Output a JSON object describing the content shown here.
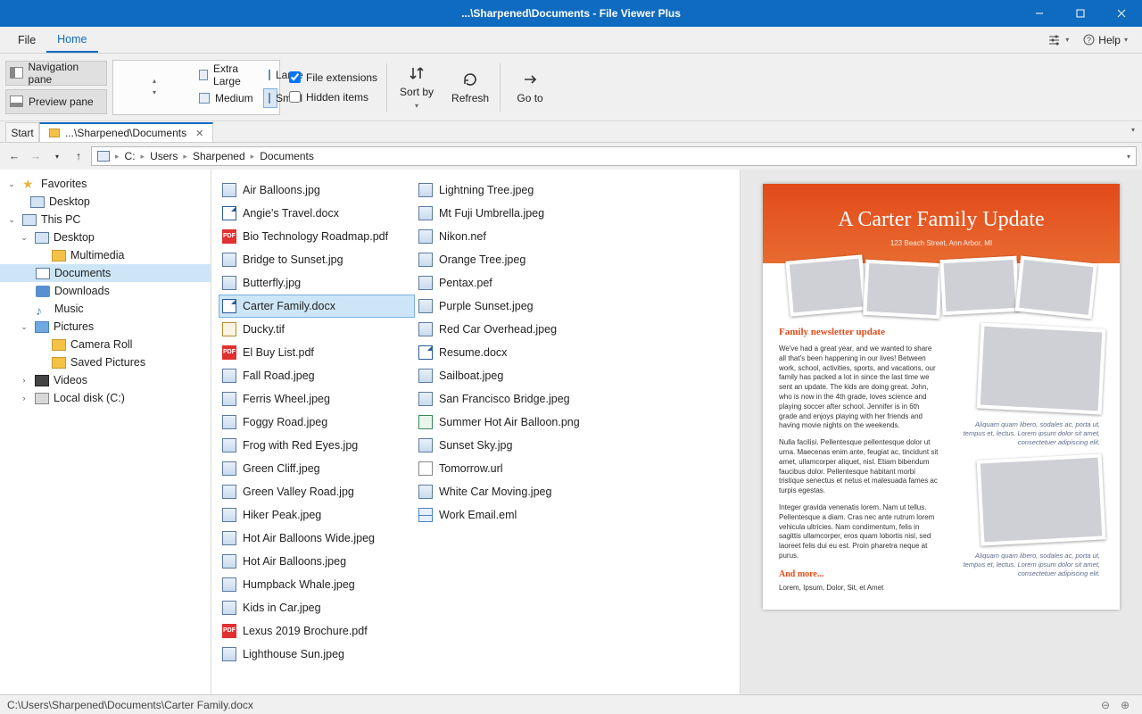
{
  "window": {
    "title": "...\\Sharpened\\Documents - File Viewer Plus"
  },
  "menu": {
    "file": "File",
    "home": "Home",
    "help": "Help"
  },
  "ribbon": {
    "nav_pane": "Navigation pane",
    "preview_pane": "Preview pane",
    "extra_large": "Extra Large",
    "large": "Large",
    "medium": "Medium",
    "small": "Small",
    "file_ext": "File extensions",
    "hidden": "Hidden items",
    "sort_by": "Sort by",
    "refresh": "Refresh",
    "go_to": "Go to"
  },
  "tabs": {
    "start": "Start",
    "current": "...\\Sharpened\\Documents"
  },
  "breadcrumb": {
    "c": "C:",
    "users": "Users",
    "sharpened": "Sharpened",
    "documents": "Documents"
  },
  "tree": {
    "favorites": "Favorites",
    "fav_desktop": "Desktop",
    "this_pc": "This PC",
    "desktop": "Desktop",
    "multimedia": "Multimedia",
    "documents": "Documents",
    "downloads": "Downloads",
    "music": "Music",
    "pictures": "Pictures",
    "camera_roll": "Camera Roll",
    "saved_pictures": "Saved Pictures",
    "videos": "Videos",
    "local_disk": "Local disk (C:)"
  },
  "files_col1": [
    {
      "n": "Air Balloons.jpg",
      "t": "img"
    },
    {
      "n": "Angie's Travel.docx",
      "t": "doc"
    },
    {
      "n": "Bio Technology Roadmap.pdf",
      "t": "pdf"
    },
    {
      "n": "Bridge to Sunset.jpg",
      "t": "img"
    },
    {
      "n": "Butterfly.jpg",
      "t": "img"
    },
    {
      "n": "Carter Family.docx",
      "t": "doc",
      "sel": true
    },
    {
      "n": "Ducky.tif",
      "t": "tif"
    },
    {
      "n": "El Buy List.pdf",
      "t": "pdf"
    },
    {
      "n": "Fall Road.jpeg",
      "t": "img"
    },
    {
      "n": "Ferris Wheel.jpeg",
      "t": "img"
    },
    {
      "n": "Foggy Road.jpeg",
      "t": "img"
    },
    {
      "n": "Frog with Red Eyes.jpg",
      "t": "img"
    },
    {
      "n": "Green Cliff.jpeg",
      "t": "img"
    },
    {
      "n": "Green Valley Road.jpg",
      "t": "img"
    },
    {
      "n": "Hiker Peak.jpeg",
      "t": "img"
    },
    {
      "n": "Hot Air Balloons Wide.jpeg",
      "t": "img"
    },
    {
      "n": "Hot Air Balloons.jpeg",
      "t": "img"
    },
    {
      "n": "Humpback Whale.jpeg",
      "t": "img"
    },
    {
      "n": "Kids in Car.jpeg",
      "t": "img"
    },
    {
      "n": "Lexus 2019 Brochure.pdf",
      "t": "pdf"
    },
    {
      "n": "Lighthouse Sun.jpeg",
      "t": "img"
    }
  ],
  "files_col2": [
    {
      "n": "Lightning Tree.jpeg",
      "t": "img"
    },
    {
      "n": "Mt Fuji Umbrella.jpeg",
      "t": "img"
    },
    {
      "n": "Nikon.nef",
      "t": "img"
    },
    {
      "n": "Orange Tree.jpeg",
      "t": "img"
    },
    {
      "n": "Pentax.pef",
      "t": "img"
    },
    {
      "n": "Purple Sunset.jpeg",
      "t": "img"
    },
    {
      "n": "Red Car Overhead.jpeg",
      "t": "img"
    },
    {
      "n": "Resume.docx",
      "t": "doc"
    },
    {
      "n": "Sailboat.jpeg",
      "t": "img"
    },
    {
      "n": "San Francisco Bridge.jpeg",
      "t": "img"
    },
    {
      "n": "Summer Hot Air Balloon.png",
      "t": "png"
    },
    {
      "n": "Sunset Sky.jpg",
      "t": "img"
    },
    {
      "n": "Tomorrow.url",
      "t": "txt"
    },
    {
      "n": "White Car Moving.jpeg",
      "t": "img"
    },
    {
      "n": "Work Email.eml",
      "t": "eml"
    }
  ],
  "preview": {
    "title": "A Carter Family Update",
    "subtitle": "123 Beach Street, Ann Arbor, MI",
    "h2": "Family newsletter update",
    "p1": "We've had a great year, and we wanted to share all that's been happening in our lives! Between work, school, activities, sports, and vacations, our family has packed a lot in since the last time we sent an update. The kids are doing great. John, who is now in the 4th grade, loves science and playing soccer after school. Jennifer is in 6th grade and enjoys playing with her friends and having movie nights on the weekends.",
    "p2": "Nulla facilisi. Pellentesque pellentesque dolor ut urna. Maecenas enim ante, feugiat ac, tincidunt sit amet, ullamcorper aliquet, nisl. Etiam bibendum faucibus dolor. Pellentesque habitant morbi tristique senectus et netus et malesuada fames ac turpis egestas.",
    "p3": "Integer gravida venenatis lorem. Nam ut tellus. Pellentesque a diam. Cras nec ante rutrum lorem vehicula ultricies. Nam condimentum, felis in sagittis ullamcorper, eros quam lobortis nisl, sed laoreet felis dui eu est. Proin pharetra neque at purus.",
    "h3": "And more...",
    "p4": "Lorem, Ipsum, Dolor, Sit, et Amet",
    "cap1": "Aliquam quam libero, sodales ac, porta ut, tempus et, lectus. Lorem ipsum dolor sit amet, consectetuer adipiscing elit.",
    "cap2": "Aliquam quam libero, sodales ac, porta ut, tempus et, lectus. Lorem ipsum dolor sit amet, consectetuer adipiscing elit."
  },
  "status": {
    "path": "C:\\Users\\Sharpened\\Documents\\Carter Family.docx"
  }
}
